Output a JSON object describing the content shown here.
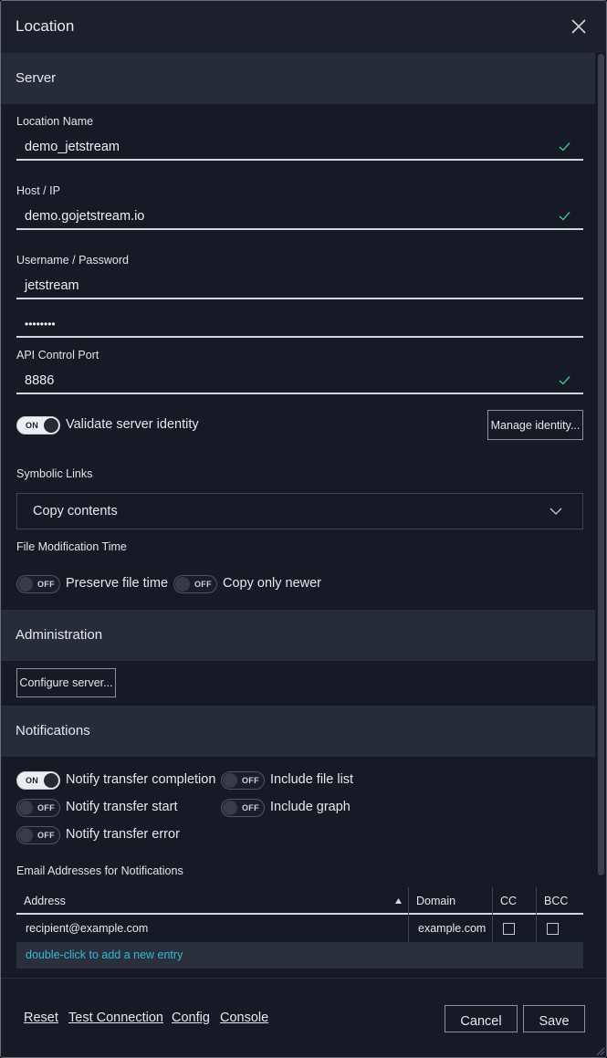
{
  "window": {
    "title": "Location"
  },
  "sections": {
    "server": "Server",
    "administration": "Administration",
    "notifications": "Notifications"
  },
  "server": {
    "location_name": {
      "label": "Location Name",
      "value": "demo_jetstream",
      "valid": true
    },
    "host": {
      "label": "Host / IP",
      "value": "demo.gojetstream.io",
      "valid": true
    },
    "credentials": {
      "label": "Username / Password",
      "username": "jetstream",
      "password": "••••••••"
    },
    "api_port": {
      "label": "API Control Port",
      "value": "8886",
      "valid": true
    },
    "validate_identity": {
      "state": "ON",
      "label": "Validate server identity"
    },
    "manage_identity_label": "Manage identity...",
    "symbolic_links": {
      "label": "Symbolic Links",
      "selected": "Copy contents"
    },
    "file_mod_time": {
      "label": "File Modification Time",
      "preserve": {
        "state": "OFF",
        "label": "Preserve file time"
      },
      "copy_newer": {
        "state": "OFF",
        "label": "Copy only newer"
      }
    }
  },
  "administration": {
    "configure_label": "Configure server..."
  },
  "notifications": {
    "transfer_completion": {
      "state": "ON",
      "label": "Notify transfer completion"
    },
    "file_list": {
      "state": "OFF",
      "label": "Include file list"
    },
    "transfer_start": {
      "state": "OFF",
      "label": "Notify transfer start"
    },
    "graph": {
      "state": "OFF",
      "label": "Include graph"
    },
    "transfer_error": {
      "state": "OFF",
      "label": "Notify transfer error"
    },
    "email_label": "Email Addresses for Notifications",
    "table": {
      "columns": [
        "Address",
        "Domain",
        "CC",
        "BCC"
      ],
      "sort_column": "Address",
      "sort_direction": "ascending",
      "rows": [
        {
          "address": "recipient@example.com",
          "domain": "example.com",
          "cc": false,
          "bcc": false
        }
      ],
      "add_hint": "double-click to add a new entry"
    }
  },
  "footer": {
    "links": [
      "Reset",
      "Test Connection",
      "Config",
      "Console"
    ],
    "cancel_label": "Cancel",
    "save_label": "Save"
  },
  "colors": {
    "accent_link": "#35b8d8",
    "valid_check": "#3fbf9a",
    "panel": "#161a24",
    "section": "#272c39"
  }
}
